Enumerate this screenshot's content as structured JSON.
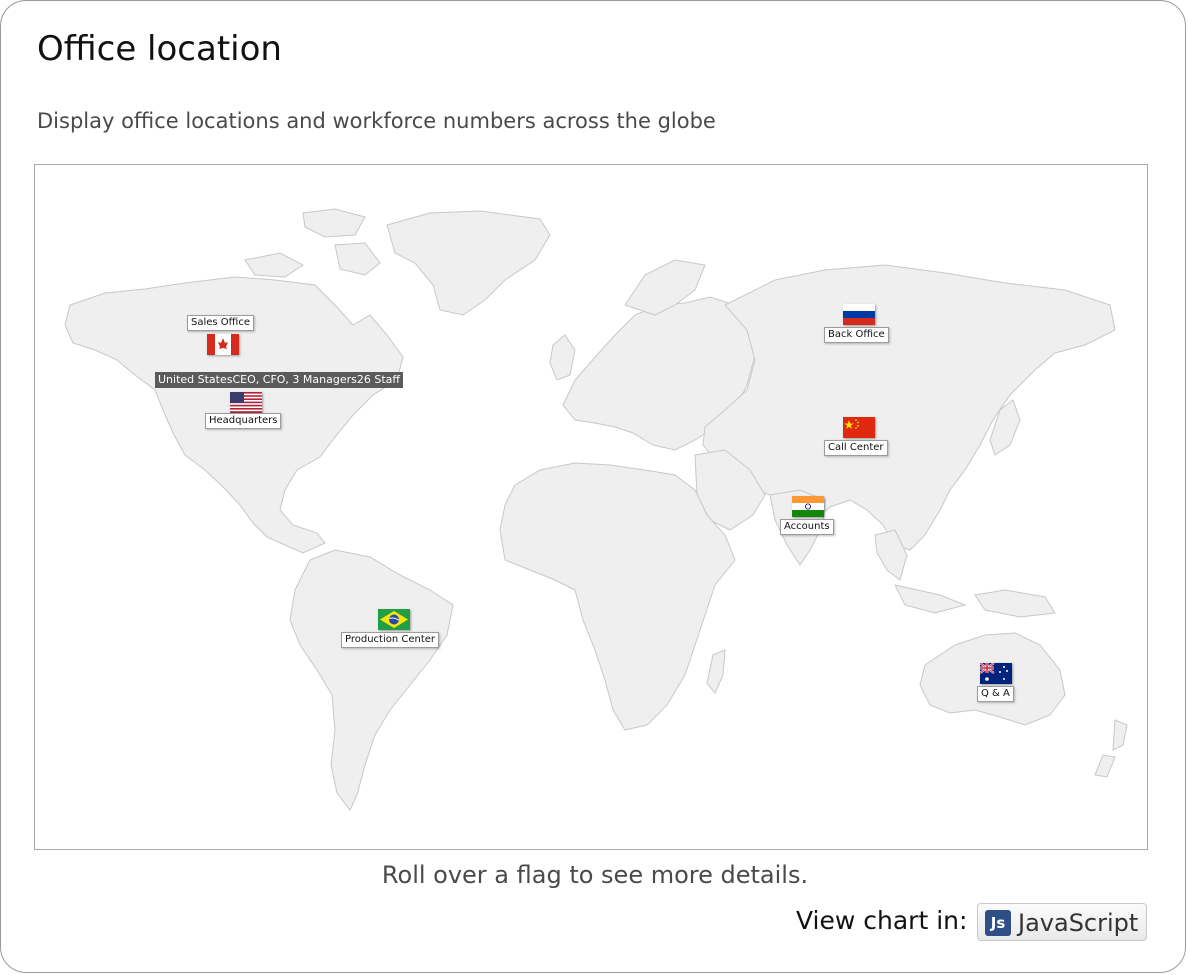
{
  "header": {
    "title": "Office location",
    "subtitle": "Display office locations and workforce numbers across the globe"
  },
  "map": {
    "land_color": "#efefef",
    "border_color": "#c8c8c8",
    "tooltip": "United StatesCEO, CFO, 3 Managers26 Staff",
    "offices": [
      {
        "country": "Canada",
        "label": "Sales Office",
        "flag": "canada-flag-icon"
      },
      {
        "country": "United States",
        "label": "Headquarters",
        "flag": "usa-flag-icon"
      },
      {
        "country": "Brazil",
        "label": "Production Center",
        "flag": "brazil-flag-icon"
      },
      {
        "country": "Russia",
        "label": "Back Office",
        "flag": "russia-flag-icon"
      },
      {
        "country": "China",
        "label": "Call Center",
        "flag": "china-flag-icon"
      },
      {
        "country": "India",
        "label": "Accounts",
        "flag": "india-flag-icon"
      },
      {
        "country": "Australia",
        "label": "Q & A",
        "flag": "australia-flag-icon"
      }
    ]
  },
  "footer": {
    "hint": "Roll over a flag to see more details.",
    "view_in_label": "View chart in:",
    "js_icon_text": "Js",
    "js_button_label": "JavaScript"
  }
}
